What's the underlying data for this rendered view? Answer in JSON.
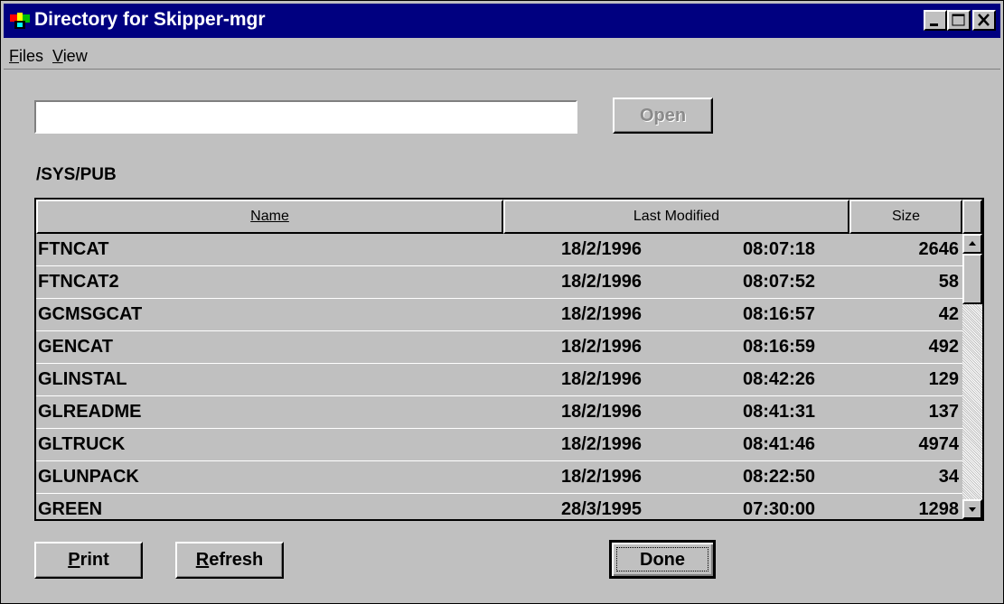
{
  "window": {
    "title": "Directory for Skipper-mgr"
  },
  "menu": {
    "files": {
      "accel": "F",
      "rest": "iles"
    },
    "view": {
      "accel": "V",
      "rest": "iew"
    }
  },
  "open_button": {
    "label": "Open"
  },
  "path_input": {
    "value": ""
  },
  "directory": "/SYS/PUB",
  "table": {
    "columns": {
      "name": "Name",
      "modified": "Last Modified",
      "size": "Size"
    },
    "rows": [
      {
        "name": "FTNCAT",
        "date": "18/2/1996",
        "time": "08:07:18",
        "size": "2646"
      },
      {
        "name": "FTNCAT2",
        "date": "18/2/1996",
        "time": "08:07:52",
        "size": "58"
      },
      {
        "name": "GCMSGCAT",
        "date": "18/2/1996",
        "time": "08:16:57",
        "size": "42"
      },
      {
        "name": "GENCAT",
        "date": "18/2/1996",
        "time": "08:16:59",
        "size": "492"
      },
      {
        "name": "GLINSTAL",
        "date": "18/2/1996",
        "time": "08:42:26",
        "size": "129"
      },
      {
        "name": "GLREADME",
        "date": "18/2/1996",
        "time": "08:41:31",
        "size": "137"
      },
      {
        "name": "GLTRUCK",
        "date": "18/2/1996",
        "time": "08:41:46",
        "size": "4974"
      },
      {
        "name": "GLUNPACK",
        "date": "18/2/1996",
        "time": "08:22:50",
        "size": "34"
      },
      {
        "name": "GREEN",
        "date": "28/3/1995",
        "time": "07:30:00",
        "size": "1298"
      }
    ]
  },
  "buttons": {
    "print": {
      "accel": "P",
      "rest": "rint"
    },
    "refresh": {
      "accel": "R",
      "rest": "efresh"
    },
    "done": "Done"
  },
  "colors": {
    "titlebar": "#000080",
    "face": "#c0c0c0"
  }
}
